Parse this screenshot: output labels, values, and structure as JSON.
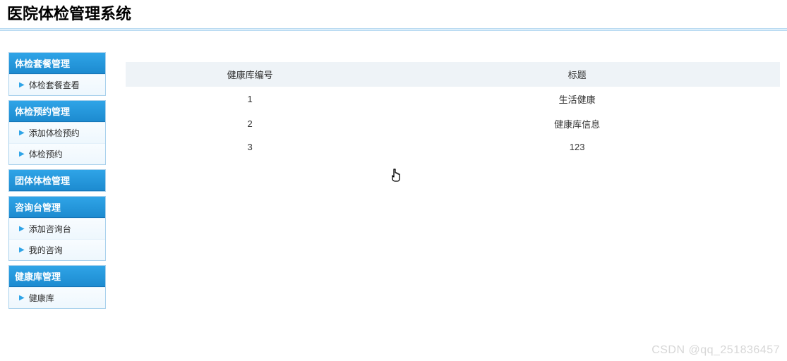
{
  "header": {
    "title": "医院体检管理系统"
  },
  "sidebar": {
    "groups": [
      {
        "label": "体检套餐管理",
        "items": [
          {
            "label": "体检套餐查看"
          }
        ]
      },
      {
        "label": "体检预约管理",
        "items": [
          {
            "label": "添加体检预约"
          },
          {
            "label": "体检预约"
          }
        ]
      },
      {
        "label": "团体体检管理",
        "items": []
      },
      {
        "label": "咨询台管理",
        "items": [
          {
            "label": "添加咨询台"
          },
          {
            "label": "我的咨询"
          }
        ]
      },
      {
        "label": "健康库管理",
        "items": [
          {
            "label": "健康库"
          }
        ]
      }
    ]
  },
  "table": {
    "columns": {
      "id": "健康库编号",
      "title": "标题"
    },
    "rows": [
      {
        "id": "1",
        "title": "生活健康"
      },
      {
        "id": "2",
        "title": "健康库信息"
      },
      {
        "id": "3",
        "title": "123"
      }
    ]
  },
  "watermark": "CSDN @qq_251836457"
}
